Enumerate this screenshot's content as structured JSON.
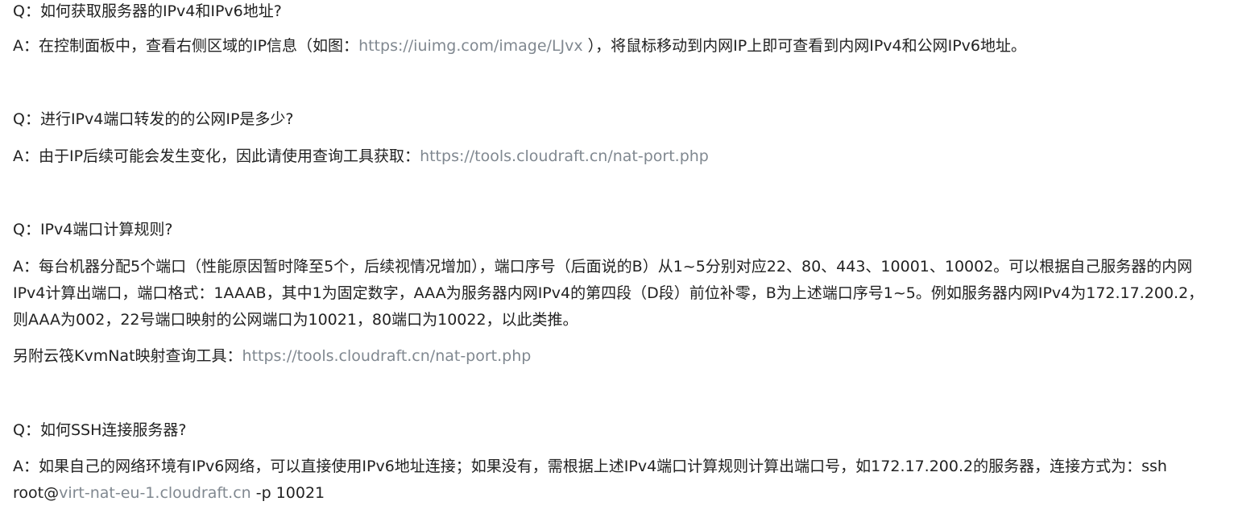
{
  "faq": {
    "q1": {
      "question": "Q：如何获取服务器的IPv4和IPv6地址?",
      "answer_prefix": "A：在控制面板中，查看右侧区域的IP信息（如图：",
      "answer_link": "https://iuimg.com/image/LJvx",
      "answer_suffix": " ），将鼠标移动到内网IP上即可查看到内网IPv4和公网IPv6地址。"
    },
    "q2": {
      "question": "Q：进行IPv4端口转发的的公网IP是多少?",
      "answer_prefix": "A：由于IP后续可能会发生变化，因此请使用查询工具获取：",
      "answer_link": "https://tools.cloudraft.cn/nat-port.php"
    },
    "q3": {
      "question": "Q：IPv4端口计算规则?",
      "answer": "A：每台机器分配5个端口（性能原因暂时降至5个，后续视情况增加），端口序号（后面说的B）从1~5分别对应22、80、443、10001、10002。可以根据自己服务器的内网IPv4计算出端口，端口格式：1AAAB，其中1为固定数字，AAA为服务器内网IPv4的第四段（D段）前位补零，B为上述端口序号1~5。例如服务器内网IPv4为172.17.200.2，则AAA为002，22号端口映射的公网端口为10021，80端口为10022，以此类推。",
      "extra_prefix": "另附云筏KvmNat映射查询工具：",
      "extra_link": "https://tools.cloudraft.cn/nat-port.php"
    },
    "q4": {
      "question": "Q：如何SSH连接服务器?",
      "answer_prefix": "A：如果自己的网络环境有IPv6网络，可以直接使用IPv6地址连接；如果没有，需根据上述IPv4端口计算规则计算出端口号，如172.17.200.2的服务器，连接方式为：ssh root@",
      "answer_link": "virt-nat-eu-1.cloudraft.cn",
      "answer_suffix": " -p 10021"
    }
  },
  "colors": {
    "text": "#222222",
    "link": "#808890",
    "background": "#ffffff"
  }
}
